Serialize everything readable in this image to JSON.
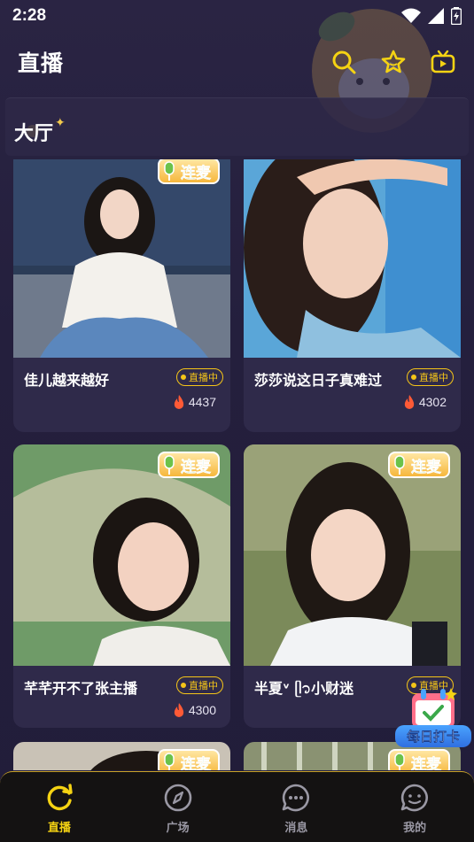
{
  "status_bar": {
    "time": "2:28"
  },
  "header": {
    "title": "直播"
  },
  "hall": {
    "label": "大厅"
  },
  "cards": [
    {
      "title": "佳儿越来越好",
      "status": "直播中",
      "heat": "4437",
      "tag": "连麦"
    },
    {
      "title": "莎莎说这日子真难过",
      "status": "直播中",
      "heat": "4302",
      "tag": ""
    },
    {
      "title": "芊芊开不了张主播",
      "status": "直播中",
      "heat": "4300",
      "tag": "连麦"
    },
    {
      "title": "半夏ᵛ ᥫ᭡小财迷",
      "status": "直播中",
      "heat": "",
      "tag": "连麦"
    },
    {
      "title": "",
      "status": "",
      "heat": "",
      "tag": "连麦"
    },
    {
      "title": "",
      "status": "",
      "heat": "",
      "tag": "连麦"
    }
  ],
  "checkin": {
    "label": "每日打卡"
  },
  "tabs": [
    {
      "label": "直播",
      "icon": "refresh-icon",
      "active": true
    },
    {
      "label": "广场",
      "icon": "compass-icon",
      "active": false
    },
    {
      "label": "消息",
      "icon": "chat-bubble-icon",
      "active": false
    },
    {
      "label": "我的",
      "icon": "smile-bubble-icon",
      "active": false
    }
  ],
  "colors": {
    "accent": "#f5d313",
    "badge": "#f5c518",
    "background": "#241f3d",
    "tabbar": "#141212"
  }
}
